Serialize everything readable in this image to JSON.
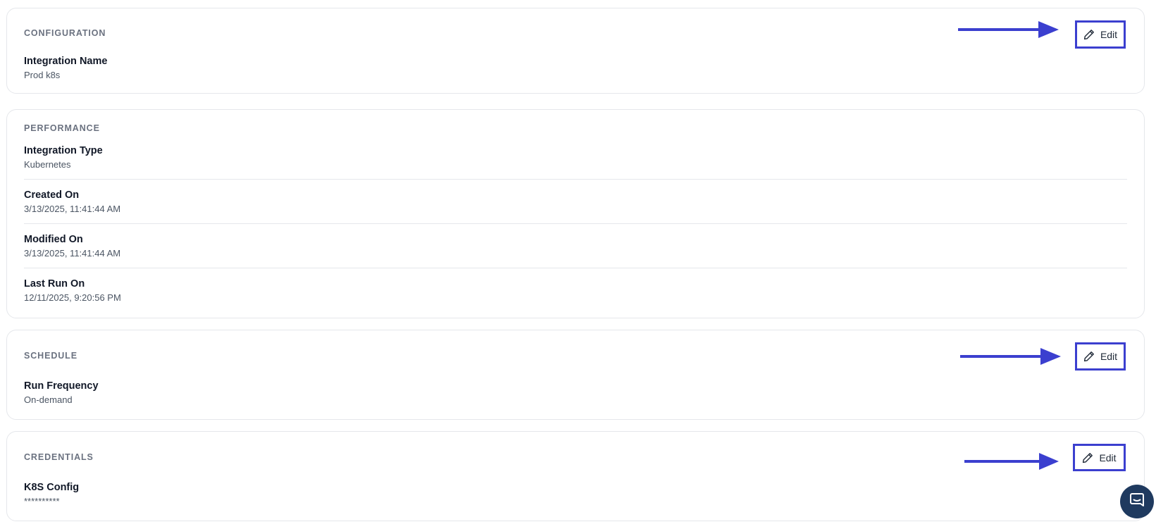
{
  "sections": {
    "configuration": {
      "title": "CONFIGURATION",
      "edit_label": "Edit",
      "fields": [
        {
          "label": "Integration Name",
          "value": "Prod k8s"
        }
      ]
    },
    "performance": {
      "title": "PERFORMANCE",
      "fields": [
        {
          "label": "Integration Type",
          "value": "Kubernetes"
        },
        {
          "label": "Created On",
          "value": "3/13/2025, 11:41:44 AM"
        },
        {
          "label": "Modified On",
          "value": "3/13/2025, 11:41:44 AM"
        },
        {
          "label": "Last Run On",
          "value": "12/11/2025, 9:20:56 PM"
        }
      ]
    },
    "schedule": {
      "title": "SCHEDULE",
      "edit_label": "Edit",
      "fields": [
        {
          "label": "Run Frequency",
          "value": "On-demand"
        }
      ]
    },
    "credentials": {
      "title": "CREDENTIALS",
      "edit_label": "Edit",
      "fields": [
        {
          "label": "K8S Config",
          "value": "**********"
        }
      ]
    }
  },
  "icons": {
    "edit": "pencil-icon",
    "annotation": "arrow-right-icon",
    "chat": "chat-icon"
  },
  "colors": {
    "annotation": "#3b3fcf",
    "chat_button": "#1f3a5f"
  }
}
